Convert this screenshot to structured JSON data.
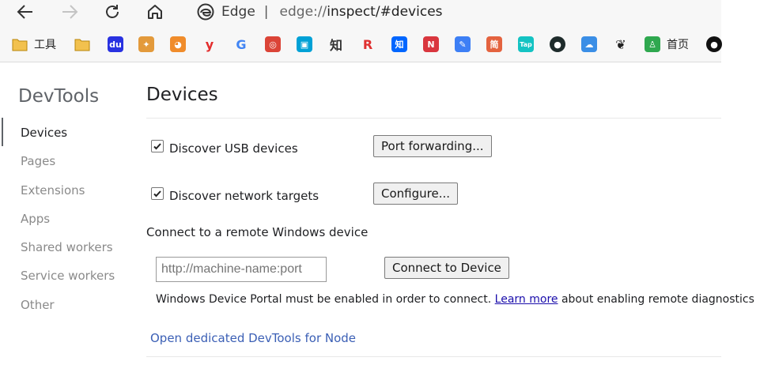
{
  "browser": {
    "brand": "Edge",
    "url_scheme": "edge://",
    "url_rest": "inspect/#devices"
  },
  "bookmarks": [
    {
      "icon": "folder-icon",
      "label": "工具",
      "color": "#f2c14e"
    },
    {
      "icon": "folder-icon",
      "label": "",
      "color": "#f2c14e"
    },
    {
      "icon": "baidu-icon",
      "label": "",
      "color": "#2932e1"
    },
    {
      "icon": "bird-icon",
      "label": "",
      "color": "#e39a3b"
    },
    {
      "icon": "mascot-icon",
      "label": "",
      "color": "#f08c2b"
    },
    {
      "icon": "y-icon",
      "label": "",
      "color": "#e32d2d"
    },
    {
      "icon": "google-icon",
      "label": "",
      "color": "#4285f4"
    },
    {
      "icon": "chrome-icon",
      "label": "",
      "color": "#db4437"
    },
    {
      "icon": "bilibili-icon",
      "label": "",
      "color": "#00a1d6"
    },
    {
      "icon": "zhi-icon",
      "label": "",
      "color": "#333333"
    },
    {
      "icon": "r-icon",
      "label": "",
      "color": "#e03131"
    },
    {
      "icon": "zhihu-icon",
      "label": "",
      "color": "#0066ff"
    },
    {
      "icon": "news-icon",
      "label": "",
      "color": "#d9363e"
    },
    {
      "icon": "blue-note-icon",
      "label": "",
      "color": "#3d7ff5"
    },
    {
      "icon": "jian-icon",
      "label": "",
      "color": "#e4633f"
    },
    {
      "icon": "tap-icon",
      "label": "",
      "color": "#14c3c3"
    },
    {
      "icon": "circle-icon",
      "label": "",
      "color": "#1e2b2b"
    },
    {
      "icon": "cloud-icon",
      "label": "",
      "color": "#3a8ee6"
    },
    {
      "icon": "leaf-icon",
      "label": "",
      "color": "#222222"
    },
    {
      "icon": "android-icon",
      "label": "首页",
      "color": "#2fa84f"
    },
    {
      "icon": "github-icon",
      "label": "",
      "color": "#111111"
    }
  ],
  "sidebar": {
    "title": "DevTools",
    "items": [
      {
        "label": "Devices",
        "active": true
      },
      {
        "label": "Pages",
        "active": false
      },
      {
        "label": "Extensions",
        "active": false
      },
      {
        "label": "Apps",
        "active": false
      },
      {
        "label": "Shared workers",
        "active": false
      },
      {
        "label": "Service workers",
        "active": false
      },
      {
        "label": "Other",
        "active": false
      }
    ]
  },
  "main": {
    "title": "Devices",
    "usb": {
      "label": "Discover USB devices",
      "checked": true,
      "button": "Port forwarding..."
    },
    "network": {
      "label": "Discover network targets",
      "checked": true,
      "button": "Configure..."
    },
    "remote_heading": "Connect to a remote Windows device",
    "remote_input_placeholder": "http://machine-name:port",
    "connect_button": "Connect to Device",
    "note_before": "Windows Device Portal must be enabled in order to connect.",
    "note_link": "Learn more",
    "note_after": "about enabling remote diagnostics",
    "node_link": "Open dedicated DevTools for Node"
  }
}
